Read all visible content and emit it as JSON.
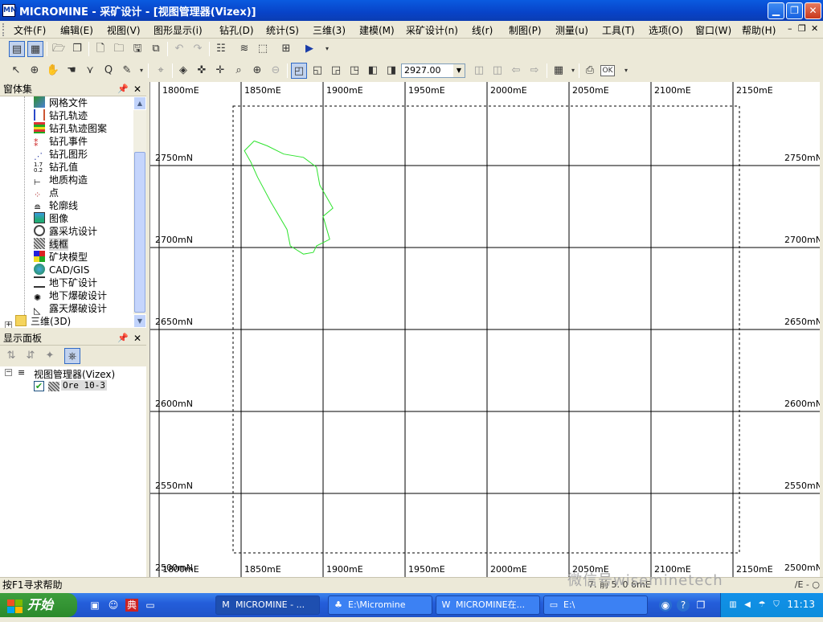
{
  "window": {
    "title": "MICROMINE - 采矿设计 - [视图管理器(Vizex)]",
    "app_icon": "MM"
  },
  "menu": [
    "文件(F)",
    "编辑(E)",
    "视图(V)",
    "图形显示(i)",
    "钻孔(D)",
    "统计(S)",
    "三维(3)",
    "建模(M)",
    "采矿设计(n)",
    "线(r)",
    "制图(P)",
    "测量(u)",
    "工具(T)",
    "选项(O)",
    "窗口(W)",
    "帮助(H)"
  ],
  "toolbar": {
    "zoom_value": "2927.00",
    "ok_label": "OK"
  },
  "forms_panel": {
    "title": "窗体集",
    "items": [
      "网格文件",
      "钻孔轨迹",
      "钻孔轨迹图案",
      "钻孔事件",
      "钻孔图形",
      "钻孔值",
      "地质构造",
      "点",
      "轮廓线",
      "图像",
      "露采坑设计",
      "线框",
      "矿块模型",
      "CAD/GIS",
      "地下矿设计",
      "地下爆破设计",
      "露天爆破设计"
    ],
    "folder": "三维(3D)",
    "selected": "线框"
  },
  "display_panel": {
    "title": "显示面板",
    "root": "视图管理器(Vizex)",
    "layer": "Ore 10-3"
  },
  "viewport": {
    "east_labels": [
      "1800mE",
      "1850mE",
      "1900mE",
      "1950mE",
      "2000mE",
      "2050mE",
      "2100mE",
      "2150mE"
    ],
    "north_labels": [
      "2750mN",
      "2700mN",
      "2650mN",
      "2600mN",
      "2550mN",
      "2500mN"
    ],
    "wireframe_color": "#2ee32e",
    "wireframe_outline": [
      [
        1858,
        2765
      ],
      [
        1866,
        2762
      ],
      [
        1876,
        2757
      ],
      [
        1888,
        2755
      ],
      [
        1896,
        2749
      ],
      [
        1898,
        2738
      ],
      [
        1902,
        2731
      ],
      [
        1906,
        2724
      ],
      [
        1900,
        2719
      ],
      [
        1904,
        2705
      ],
      [
        1896,
        2701
      ],
      [
        1894,
        2697
      ],
      [
        1888,
        2696
      ],
      [
        1880,
        2701
      ],
      [
        1878,
        2711
      ],
      [
        1868,
        2728
      ],
      [
        1860,
        2743
      ],
      [
        1856,
        2752
      ],
      [
        1852,
        2759
      ],
      [
        1858,
        2765
      ]
    ]
  },
  "status": {
    "help": "按F1寻求帮助",
    "coords": "7. 前 5. 0  6mE",
    "mode": "/E - ○"
  },
  "taskbar": {
    "start": "开始",
    "tasks": [
      "MICROMINE - ...",
      "E:\\Micromine",
      "MICROMINE在...",
      "E:\\"
    ],
    "clock": "11:13"
  },
  "watermark": "微信号wiseminetech"
}
